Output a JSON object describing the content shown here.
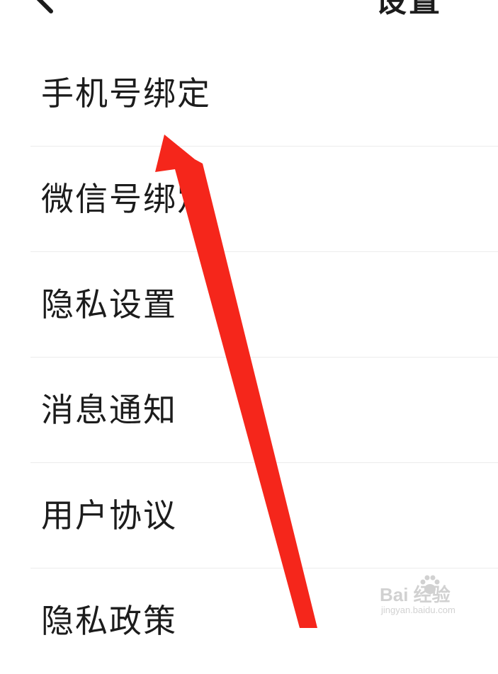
{
  "header": {
    "title": "设置",
    "back_icon": "chevron-left-icon"
  },
  "settings": {
    "items": [
      {
        "label": "手机号绑定"
      },
      {
        "label": "微信号绑定"
      },
      {
        "label": "隐私设置"
      },
      {
        "label": "消息通知"
      },
      {
        "label": "用户协议"
      },
      {
        "label": "隐私政策"
      }
    ]
  },
  "annotation": {
    "arrow_color": "#f5261b",
    "arrow_icon": "red-arrow-pointer"
  },
  "watermark": {
    "logo": "Bai 经验",
    "subtext": "jingyan.baidu.com"
  },
  "colors": {
    "text": "#1c1c1c",
    "divider": "#ececec",
    "background": "#ffffff"
  }
}
